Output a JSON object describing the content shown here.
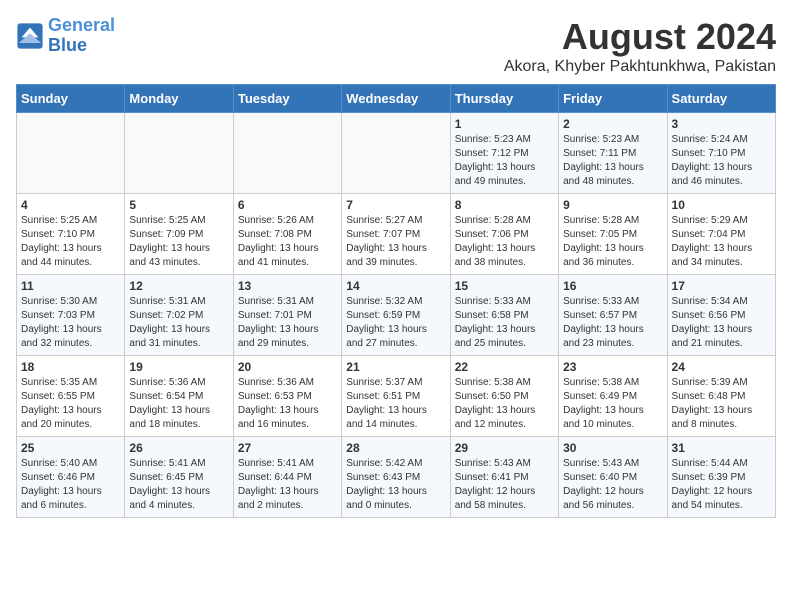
{
  "logo": {
    "line1": "General",
    "line2": "Blue"
  },
  "title": "August 2024",
  "location": "Akora, Khyber Pakhtunkhwa, Pakistan",
  "days_of_week": [
    "Sunday",
    "Monday",
    "Tuesday",
    "Wednesday",
    "Thursday",
    "Friday",
    "Saturday"
  ],
  "weeks": [
    [
      {
        "day": "",
        "sunrise": "",
        "sunset": "",
        "daylight": ""
      },
      {
        "day": "",
        "sunrise": "",
        "sunset": "",
        "daylight": ""
      },
      {
        "day": "",
        "sunrise": "",
        "sunset": "",
        "daylight": ""
      },
      {
        "day": "",
        "sunrise": "",
        "sunset": "",
        "daylight": ""
      },
      {
        "day": "1",
        "sunrise": "Sunrise: 5:23 AM",
        "sunset": "Sunset: 7:12 PM",
        "daylight": "Daylight: 13 hours and 49 minutes."
      },
      {
        "day": "2",
        "sunrise": "Sunrise: 5:23 AM",
        "sunset": "Sunset: 7:11 PM",
        "daylight": "Daylight: 13 hours and 48 minutes."
      },
      {
        "day": "3",
        "sunrise": "Sunrise: 5:24 AM",
        "sunset": "Sunset: 7:10 PM",
        "daylight": "Daylight: 13 hours and 46 minutes."
      }
    ],
    [
      {
        "day": "4",
        "sunrise": "Sunrise: 5:25 AM",
        "sunset": "Sunset: 7:10 PM",
        "daylight": "Daylight: 13 hours and 44 minutes."
      },
      {
        "day": "5",
        "sunrise": "Sunrise: 5:25 AM",
        "sunset": "Sunset: 7:09 PM",
        "daylight": "Daylight: 13 hours and 43 minutes."
      },
      {
        "day": "6",
        "sunrise": "Sunrise: 5:26 AM",
        "sunset": "Sunset: 7:08 PM",
        "daylight": "Daylight: 13 hours and 41 minutes."
      },
      {
        "day": "7",
        "sunrise": "Sunrise: 5:27 AM",
        "sunset": "Sunset: 7:07 PM",
        "daylight": "Daylight: 13 hours and 39 minutes."
      },
      {
        "day": "8",
        "sunrise": "Sunrise: 5:28 AM",
        "sunset": "Sunset: 7:06 PM",
        "daylight": "Daylight: 13 hours and 38 minutes."
      },
      {
        "day": "9",
        "sunrise": "Sunrise: 5:28 AM",
        "sunset": "Sunset: 7:05 PM",
        "daylight": "Daylight: 13 hours and 36 minutes."
      },
      {
        "day": "10",
        "sunrise": "Sunrise: 5:29 AM",
        "sunset": "Sunset: 7:04 PM",
        "daylight": "Daylight: 13 hours and 34 minutes."
      }
    ],
    [
      {
        "day": "11",
        "sunrise": "Sunrise: 5:30 AM",
        "sunset": "Sunset: 7:03 PM",
        "daylight": "Daylight: 13 hours and 32 minutes."
      },
      {
        "day": "12",
        "sunrise": "Sunrise: 5:31 AM",
        "sunset": "Sunset: 7:02 PM",
        "daylight": "Daylight: 13 hours and 31 minutes."
      },
      {
        "day": "13",
        "sunrise": "Sunrise: 5:31 AM",
        "sunset": "Sunset: 7:01 PM",
        "daylight": "Daylight: 13 hours and 29 minutes."
      },
      {
        "day": "14",
        "sunrise": "Sunrise: 5:32 AM",
        "sunset": "Sunset: 6:59 PM",
        "daylight": "Daylight: 13 hours and 27 minutes."
      },
      {
        "day": "15",
        "sunrise": "Sunrise: 5:33 AM",
        "sunset": "Sunset: 6:58 PM",
        "daylight": "Daylight: 13 hours and 25 minutes."
      },
      {
        "day": "16",
        "sunrise": "Sunrise: 5:33 AM",
        "sunset": "Sunset: 6:57 PM",
        "daylight": "Daylight: 13 hours and 23 minutes."
      },
      {
        "day": "17",
        "sunrise": "Sunrise: 5:34 AM",
        "sunset": "Sunset: 6:56 PM",
        "daylight": "Daylight: 13 hours and 21 minutes."
      }
    ],
    [
      {
        "day": "18",
        "sunrise": "Sunrise: 5:35 AM",
        "sunset": "Sunset: 6:55 PM",
        "daylight": "Daylight: 13 hours and 20 minutes."
      },
      {
        "day": "19",
        "sunrise": "Sunrise: 5:36 AM",
        "sunset": "Sunset: 6:54 PM",
        "daylight": "Daylight: 13 hours and 18 minutes."
      },
      {
        "day": "20",
        "sunrise": "Sunrise: 5:36 AM",
        "sunset": "Sunset: 6:53 PM",
        "daylight": "Daylight: 13 hours and 16 minutes."
      },
      {
        "day": "21",
        "sunrise": "Sunrise: 5:37 AM",
        "sunset": "Sunset: 6:51 PM",
        "daylight": "Daylight: 13 hours and 14 minutes."
      },
      {
        "day": "22",
        "sunrise": "Sunrise: 5:38 AM",
        "sunset": "Sunset: 6:50 PM",
        "daylight": "Daylight: 13 hours and 12 minutes."
      },
      {
        "day": "23",
        "sunrise": "Sunrise: 5:38 AM",
        "sunset": "Sunset: 6:49 PM",
        "daylight": "Daylight: 13 hours and 10 minutes."
      },
      {
        "day": "24",
        "sunrise": "Sunrise: 5:39 AM",
        "sunset": "Sunset: 6:48 PM",
        "daylight": "Daylight: 13 hours and 8 minutes."
      }
    ],
    [
      {
        "day": "25",
        "sunrise": "Sunrise: 5:40 AM",
        "sunset": "Sunset: 6:46 PM",
        "daylight": "Daylight: 13 hours and 6 minutes."
      },
      {
        "day": "26",
        "sunrise": "Sunrise: 5:41 AM",
        "sunset": "Sunset: 6:45 PM",
        "daylight": "Daylight: 13 hours and 4 minutes."
      },
      {
        "day": "27",
        "sunrise": "Sunrise: 5:41 AM",
        "sunset": "Sunset: 6:44 PM",
        "daylight": "Daylight: 13 hours and 2 minutes."
      },
      {
        "day": "28",
        "sunrise": "Sunrise: 5:42 AM",
        "sunset": "Sunset: 6:43 PM",
        "daylight": "Daylight: 13 hours and 0 minutes."
      },
      {
        "day": "29",
        "sunrise": "Sunrise: 5:43 AM",
        "sunset": "Sunset: 6:41 PM",
        "daylight": "Daylight: 12 hours and 58 minutes."
      },
      {
        "day": "30",
        "sunrise": "Sunrise: 5:43 AM",
        "sunset": "Sunset: 6:40 PM",
        "daylight": "Daylight: 12 hours and 56 minutes."
      },
      {
        "day": "31",
        "sunrise": "Sunrise: 5:44 AM",
        "sunset": "Sunset: 6:39 PM",
        "daylight": "Daylight: 12 hours and 54 minutes."
      }
    ]
  ]
}
